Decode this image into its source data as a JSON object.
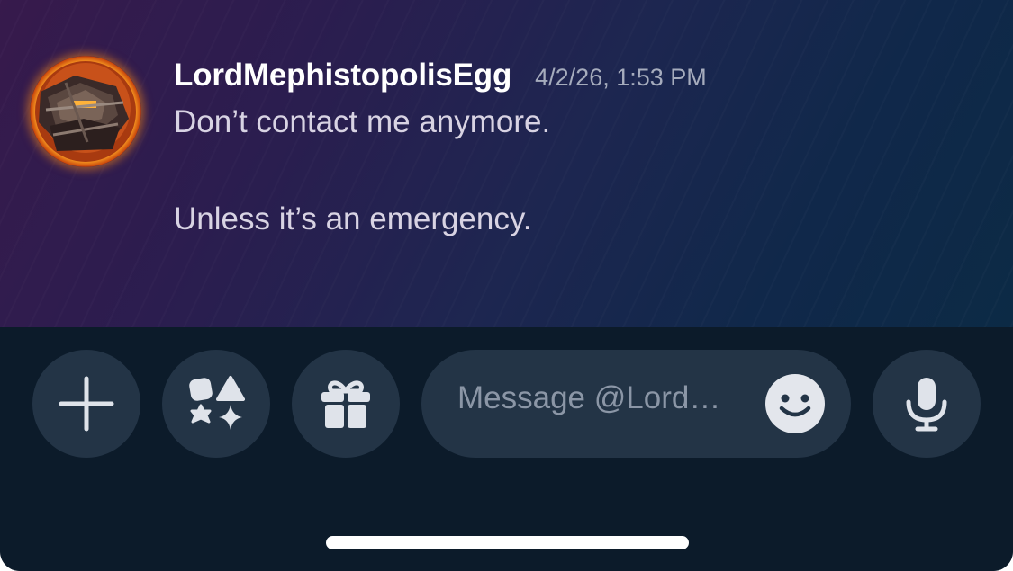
{
  "message": {
    "username": "LordMephistopolisEgg",
    "timestamp": "4/2/26, 1:53 PM",
    "lines": [
      "Don’t contact me anymore.",
      "Unless it’s an emergency."
    ]
  },
  "composer": {
    "placeholder": "Message @Lord…",
    "buttons": {
      "add": "plus-icon",
      "apps": "apps-icon",
      "gift": "gift-icon",
      "emoji": "smiley-icon",
      "voice": "microphone-icon"
    }
  },
  "colors": {
    "chat_gradient_start": "#371a4c",
    "chat_gradient_end": "#0c2a45",
    "composer_bg": "#0c1b2a",
    "button_bg": "#233446",
    "icon": "#dfe3ea",
    "username": "#ffffff",
    "timestamp": "#a6acbd",
    "message_text": "#d8d3e3"
  }
}
